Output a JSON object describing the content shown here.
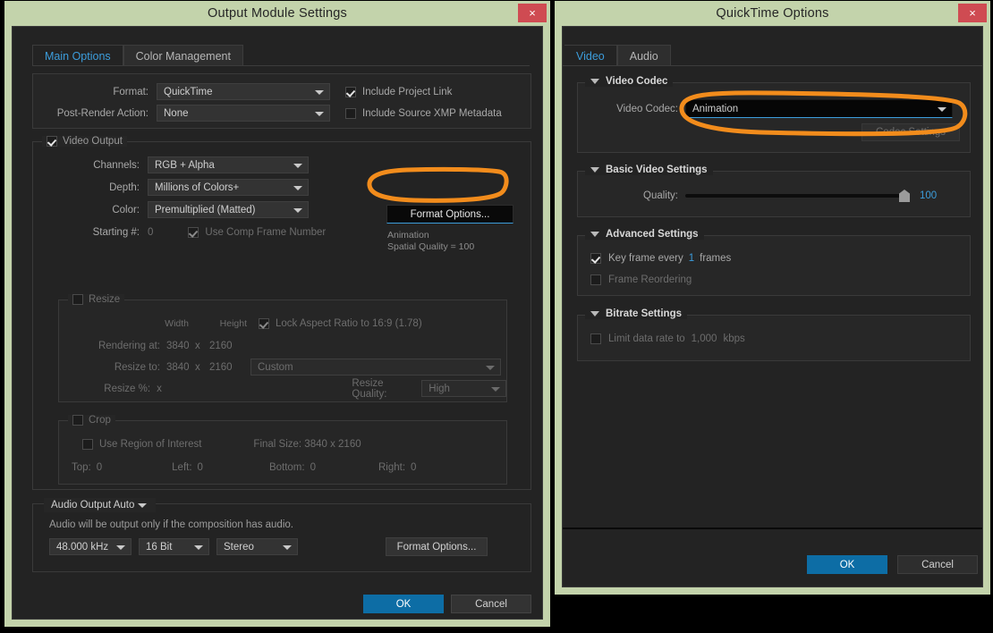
{
  "left_window": {
    "title": "Output Module Settings",
    "close_label": "×",
    "tabs": [
      {
        "label": "Main Options",
        "active": true
      },
      {
        "label": "Color Management",
        "active": false
      }
    ],
    "format_section": {
      "format_label": "Format:",
      "format_value": "QuickTime",
      "post_render_label": "Post-Render Action:",
      "post_render_value": "None",
      "include_project_link": "Include Project Link",
      "include_project_link_checked": true,
      "include_xmp": "Include Source XMP Metadata",
      "include_xmp_checked": false
    },
    "video_output": {
      "group_label": "Video Output",
      "group_checked": true,
      "channels_label": "Channels:",
      "channels_value": "RGB + Alpha",
      "depth_label": "Depth:",
      "depth_value": "Millions of Colors+",
      "color_label": "Color:",
      "color_value": "Premultiplied (Matted)",
      "starting_label": "Starting #:",
      "starting_value": "0",
      "use_comp_frame_number": "Use Comp Frame Number",
      "use_comp_frame_checked": true,
      "format_options_button": "Format Options...",
      "format_summary_line1": "Animation",
      "format_summary_line2": "Spatial Quality = 100"
    },
    "resize": {
      "group_label": "Resize",
      "group_checked": false,
      "width_header": "Width",
      "height_header": "Height",
      "lock_aspect_label": "Lock Aspect Ratio to 16:9 (1.78)",
      "lock_aspect_checked": true,
      "rendering_at_label": "Rendering at:",
      "rendering_at_width": "3840",
      "rendering_at_x": "x",
      "rendering_at_height": "2160",
      "resize_to_label": "Resize to:",
      "resize_to_width": "3840",
      "resize_to_x": "x",
      "resize_to_height": "2160",
      "resize_preset": "Custom",
      "resize_pct_label": "Resize %:",
      "resize_pct_x": "x",
      "resize_quality_label": "Resize Quality:",
      "resize_quality_value": "High"
    },
    "crop": {
      "group_label": "Crop",
      "group_checked": false,
      "use_region_label": "Use Region of Interest",
      "use_region_checked": false,
      "final_size_label": "Final Size: 3840 x 2160",
      "top_label": "Top:",
      "top_value": "0",
      "left_label": "Left:",
      "left_value": "0",
      "bottom_label": "Bottom:",
      "bottom_value": "0",
      "right_label": "Right:",
      "right_value": "0"
    },
    "audio": {
      "group_label": "Audio Output Auto",
      "note": "Audio will be output only if the composition has audio.",
      "sample_rate": "48.000 kHz",
      "bit_depth": "16 Bit",
      "channels": "Stereo",
      "format_options_button": "Format Options..."
    },
    "ok_label": "OK",
    "cancel_label": "Cancel"
  },
  "right_window": {
    "title": "QuickTime Options",
    "close_label": "×",
    "tabs": [
      {
        "label": "Video",
        "active": true
      },
      {
        "label": "Audio",
        "active": false
      }
    ],
    "video_codec": {
      "section_title": "Video Codec",
      "label": "Video Codec:",
      "value": "Animation",
      "codec_settings_button": "Codec Settings"
    },
    "basic_video": {
      "section_title": "Basic Video Settings",
      "quality_label": "Quality:",
      "quality_value": "100",
      "quality_percent": 100
    },
    "advanced": {
      "section_title": "Advanced Settings",
      "key_frame_prefix": "Key frame every",
      "key_frame_value": "1",
      "key_frame_suffix": "frames",
      "key_frame_checked": true,
      "frame_reordering_label": "Frame Reordering",
      "frame_reordering_checked": false
    },
    "bitrate": {
      "section_title": "Bitrate Settings",
      "limit_label": "Limit data rate to",
      "limit_value": "1,000",
      "limit_units": "kbps",
      "limit_checked": false
    },
    "ok_label": "OK",
    "cancel_label": "Cancel"
  },
  "annotations": {
    "color": "#f28c1c",
    "shapes": [
      "ellipse-around-format-options",
      "ellipse-around-video-codec"
    ]
  },
  "theme": {
    "window_frame": "#c3d3ab",
    "panel_bg": "#232323",
    "accent_blue": "#3c9ddc",
    "ok_button": "#0d6da5",
    "close_red": "#cf4b52"
  }
}
